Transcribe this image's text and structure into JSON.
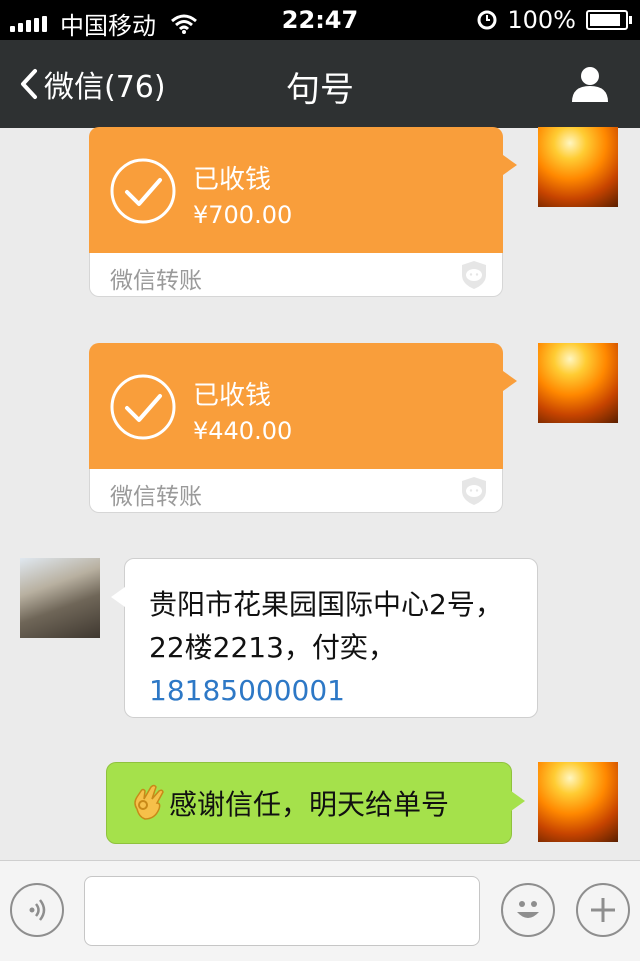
{
  "status_bar": {
    "carrier": "中国移动",
    "time": "22:47",
    "battery": "100%",
    "battery_level": 1.0
  },
  "nav": {
    "back_label": "微信(76)",
    "title": "句号"
  },
  "messages": [
    {
      "type": "transfer",
      "status": "已收钱",
      "amount": "¥700.00",
      "label": "微信转账"
    },
    {
      "type": "transfer",
      "status": "已收钱",
      "amount": "¥440.00",
      "label": "微信转账"
    },
    {
      "type": "text",
      "text": "贵阳市花果园国际中心2号，22楼2213，付奕，",
      "phone": "18185000001"
    },
    {
      "type": "text",
      "emoji": "ok-hand-icon",
      "text": "感谢信任，明天给单号"
    }
  ],
  "input": {
    "placeholder": ""
  },
  "colors": {
    "nav_bg": "#2e3132",
    "transfer_orange": "#f99e3b",
    "bubble_green": "#a5e14b",
    "link_blue": "#2d78c6"
  }
}
